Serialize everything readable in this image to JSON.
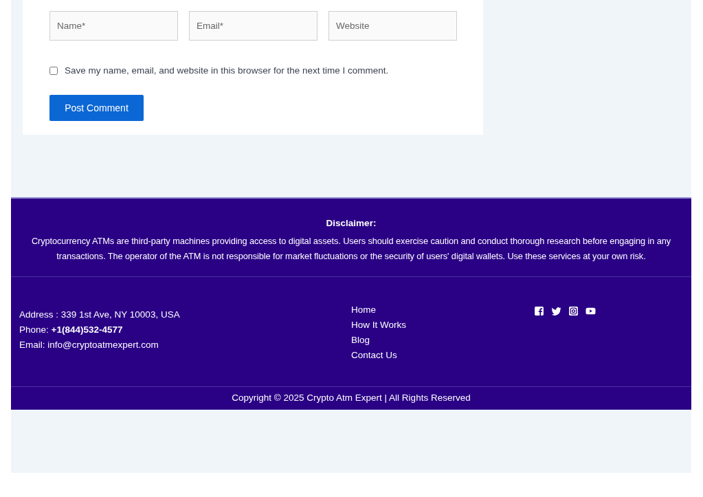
{
  "comment_form": {
    "fields": [
      {
        "placeholder": "Name*"
      },
      {
        "placeholder": "Email*"
      },
      {
        "placeholder": "Website"
      }
    ],
    "consent": {
      "label": "Save my name, email, and website in this browser for the next time I comment.",
      "checked": false
    },
    "submit": "Post Comment"
  },
  "footer": {
    "disclaimer": {
      "title": "Disclaimer:",
      "text": "Cryptocurrency ATMs are third-party machines providing access to digital assets. Users should exercise caution and conduct thorough research before engaging in any transactions. The operator of the ATM is not responsible for market fluctuations or the security of users' digital wallets. Use these services at your own risk."
    },
    "contact": [
      "Address : 339 1st Ave, NY 10003, USA",
      "Phone: **+1(844)532-4577**",
      "Email: info@cryptoatmexpert.com"
    ],
    "links": [
      "Home",
      "How It Works",
      "Blog",
      "Contact Us"
    ],
    "social": [
      {
        "kind": "facebook"
      },
      {
        "kind": "twitter"
      },
      {
        "kind": "instagram"
      },
      {
        "kind": "youtube"
      }
    ],
    "copyright": "Copyright © 2025 Crypto Atm Expert | All Rights Reserved"
  }
}
